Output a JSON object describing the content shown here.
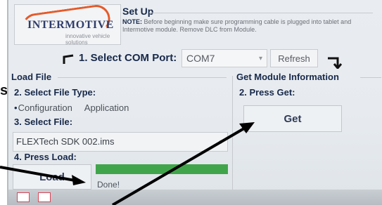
{
  "header": {
    "logo_text": "INTERMOTIVE",
    "logo_sub": "innovative vehicle solutions",
    "setup_title": "Set Up",
    "note_label": "NOTE:",
    "note_text": "Before beginning make sure programming cable is plugged into tablet and Intermotive module. Remove DLC from Module."
  },
  "com_port": {
    "label": "1. Select COM Port:",
    "selected": "COM7",
    "refresh_label": "Refresh"
  },
  "load_file": {
    "group_title": "Load File",
    "step2_label": "2. Select File Type:",
    "file_types": [
      {
        "label": "Configuration",
        "selected": true
      },
      {
        "label": "Application",
        "selected": false
      }
    ],
    "step3_label": "3. Select File:",
    "selected_file": "FLEXTech SDK 002.ims",
    "step4_label": "4. Press Load:",
    "load_button": "Load",
    "progress": 1.0,
    "status_text": "Done!"
  },
  "module_info": {
    "group_title": "Get Module Information",
    "step2_label": "2. Press Get:",
    "get_button": "Get"
  },
  "outside_text": "s",
  "colors": {
    "title_navy": "#17284a",
    "progress_green": "#40a54a",
    "logo_orange": "#e45b2b",
    "annotation_arrow": "#000000"
  }
}
